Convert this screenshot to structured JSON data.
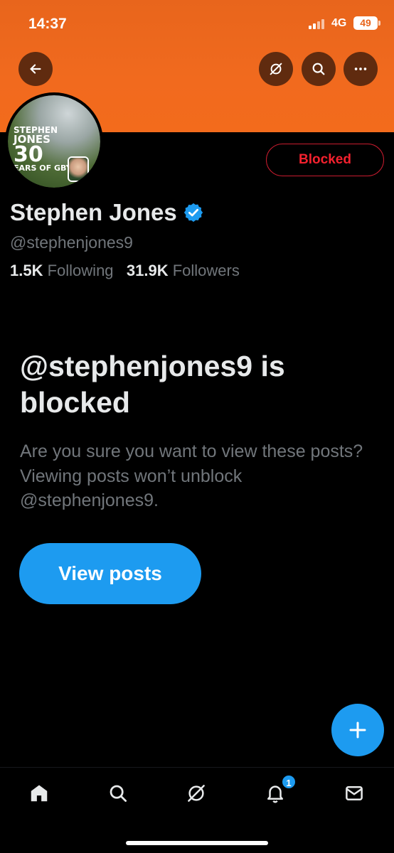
{
  "status_bar": {
    "time": "14:37",
    "network": "4G",
    "battery": "49"
  },
  "header": {
    "back_icon": "arrow-left-icon",
    "grok_icon": "grok-slash-icon",
    "search_icon": "search-icon",
    "more_icon": "more-horizontal-icon"
  },
  "profile": {
    "avatar_text": [
      "STEPHEN",
      "JONES",
      "30",
      "EARS OF",
      "GBY"
    ],
    "display_name": "Stephen Jones",
    "verified": true,
    "handle": "@stephenjones9",
    "following_count": "1.5K",
    "following_label": "Following",
    "followers_count": "31.9K",
    "followers_label": "Followers",
    "blocked_label": "Blocked"
  },
  "blocked_notice": {
    "title": "@stephenjones9 is blocked",
    "description": "Are you sure you want to view these posts? Viewing posts won’t unblock @stephenjones9.",
    "button_label": "View posts"
  },
  "fab": {
    "icon": "plus-icon"
  },
  "tab_bar": {
    "items": [
      {
        "name": "home",
        "icon": "home-icon"
      },
      {
        "name": "search",
        "icon": "search-icon"
      },
      {
        "name": "grok",
        "icon": "grok-slash-icon"
      },
      {
        "name": "notifications",
        "icon": "bell-icon",
        "badge": "1"
      },
      {
        "name": "messages",
        "icon": "mail-icon"
      }
    ]
  },
  "colors": {
    "accent": "#1d9bf0",
    "banner": "#f16a1e",
    "blocked": "#f4212e",
    "muted": "#71767b"
  }
}
